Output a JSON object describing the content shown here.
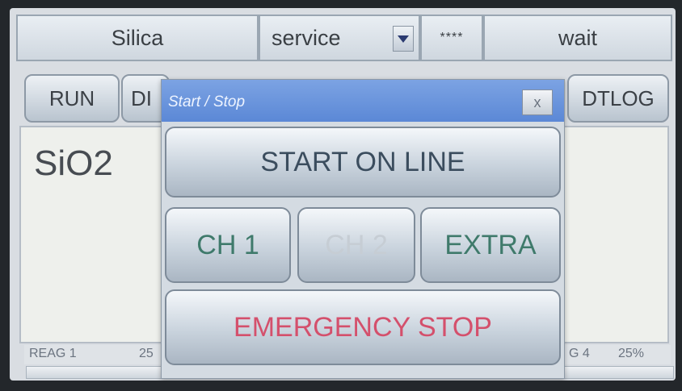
{
  "header": {
    "title": "Silica",
    "user": "service",
    "password_mask": "****",
    "status": "wait"
  },
  "tabs": {
    "run": "RUN",
    "di": "DI",
    "dtlog": "DTLOG"
  },
  "main": {
    "parameter": "SiO2"
  },
  "reagents": {
    "reag1_label": "REAG 1",
    "reag1_value": "25",
    "reag4_label": "G 4",
    "reag4_value": "25%"
  },
  "dialog": {
    "title": "Start / Stop",
    "close_label": "x",
    "start_online": "START ON LINE",
    "ch1": "CH 1",
    "ch2": "CH 2",
    "extra": "EXTRA",
    "emergency_stop": "EMERGENCY STOP"
  },
  "colors": {
    "title_bar": "#5b88d6",
    "channel_text": "#3f7a6b",
    "emergency_text": "#d4506c",
    "disabled_text": "#c6cdd4"
  }
}
